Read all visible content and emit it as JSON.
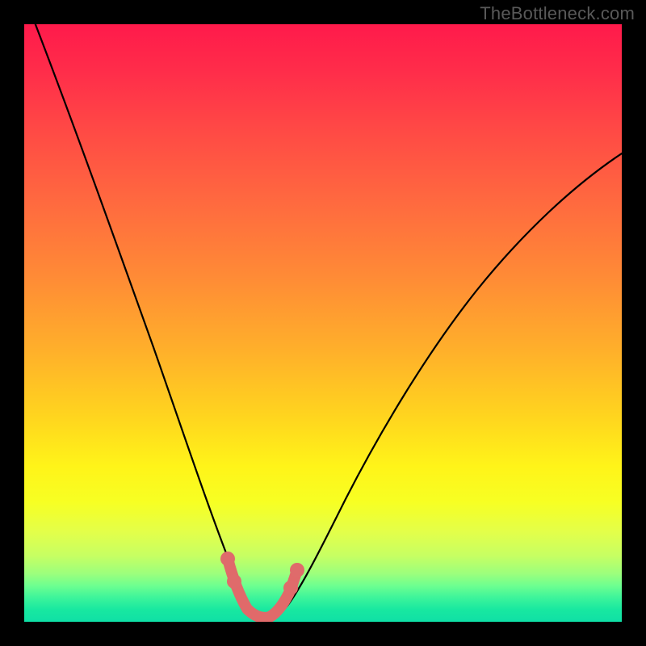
{
  "watermark": "TheBottleneck.com",
  "chart_data": {
    "type": "line",
    "title": "",
    "xlabel": "",
    "ylabel": "",
    "xlim": [
      0,
      100
    ],
    "ylim": [
      0,
      100
    ],
    "grid": false,
    "legend": false,
    "series": [
      {
        "name": "bottleneck-curve",
        "x": [
          0,
          5,
          10,
          15,
          20,
          25,
          30,
          34,
          36,
          38,
          40,
          42,
          44,
          48,
          55,
          65,
          75,
          85,
          95,
          100
        ],
        "values": [
          100,
          88,
          75,
          62,
          48,
          33,
          18,
          6,
          3,
          1,
          1,
          3,
          7,
          16,
          30,
          45,
          56,
          65,
          72,
          75
        ]
      }
    ],
    "highlight_segment": {
      "name": "optimal-range",
      "x": [
        33,
        35,
        37,
        39,
        41,
        43
      ],
      "values": [
        9,
        4,
        1,
        1,
        4,
        8
      ]
    },
    "background_gradient": {
      "top_color": "#ff1a4b",
      "mid_color": "#fff419",
      "bottom_color": "#0fe0a6"
    }
  }
}
